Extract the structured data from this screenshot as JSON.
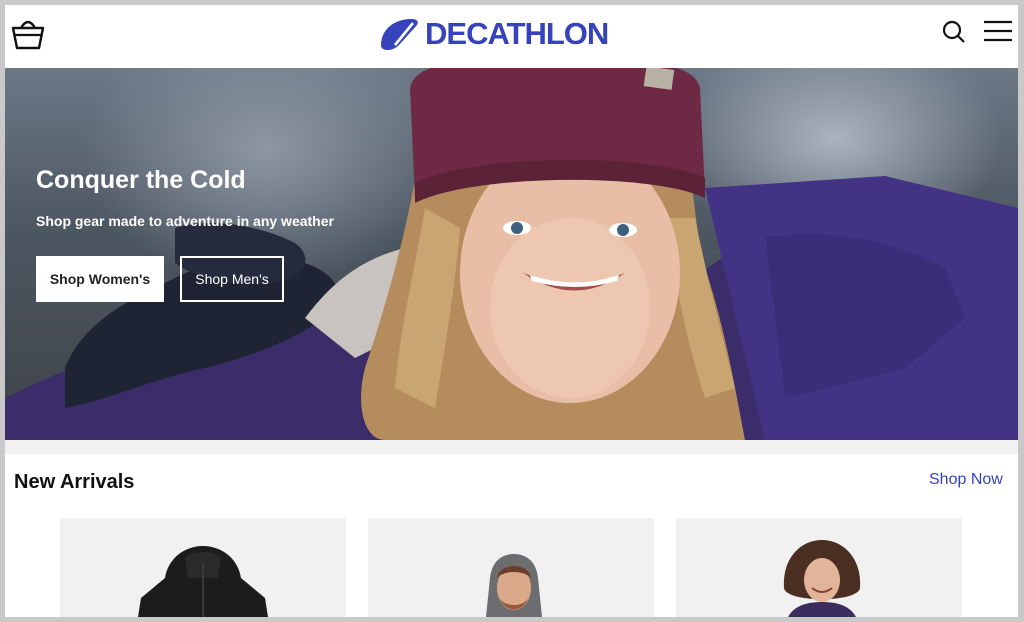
{
  "header": {
    "brand": "DECATHLON",
    "icons": {
      "cart": "basket-icon",
      "search": "search-icon",
      "menu": "hamburger-menu-icon"
    }
  },
  "hero": {
    "title": "Conquer the Cold",
    "subtitle": "Shop gear made to adventure in any weather",
    "primary_button": "Shop Women's",
    "secondary_button": "Shop Men's"
  },
  "new_arrivals": {
    "title": "New Arrivals",
    "link": "Shop Now",
    "products": [
      {
        "image": "black hooded jacket"
      },
      {
        "image": "man in grey hood"
      },
      {
        "image": "woman in purple jacket"
      }
    ]
  },
  "colors": {
    "brand": "#3643ba",
    "text": "#111111",
    "card_bg": "#f1f1f1"
  }
}
